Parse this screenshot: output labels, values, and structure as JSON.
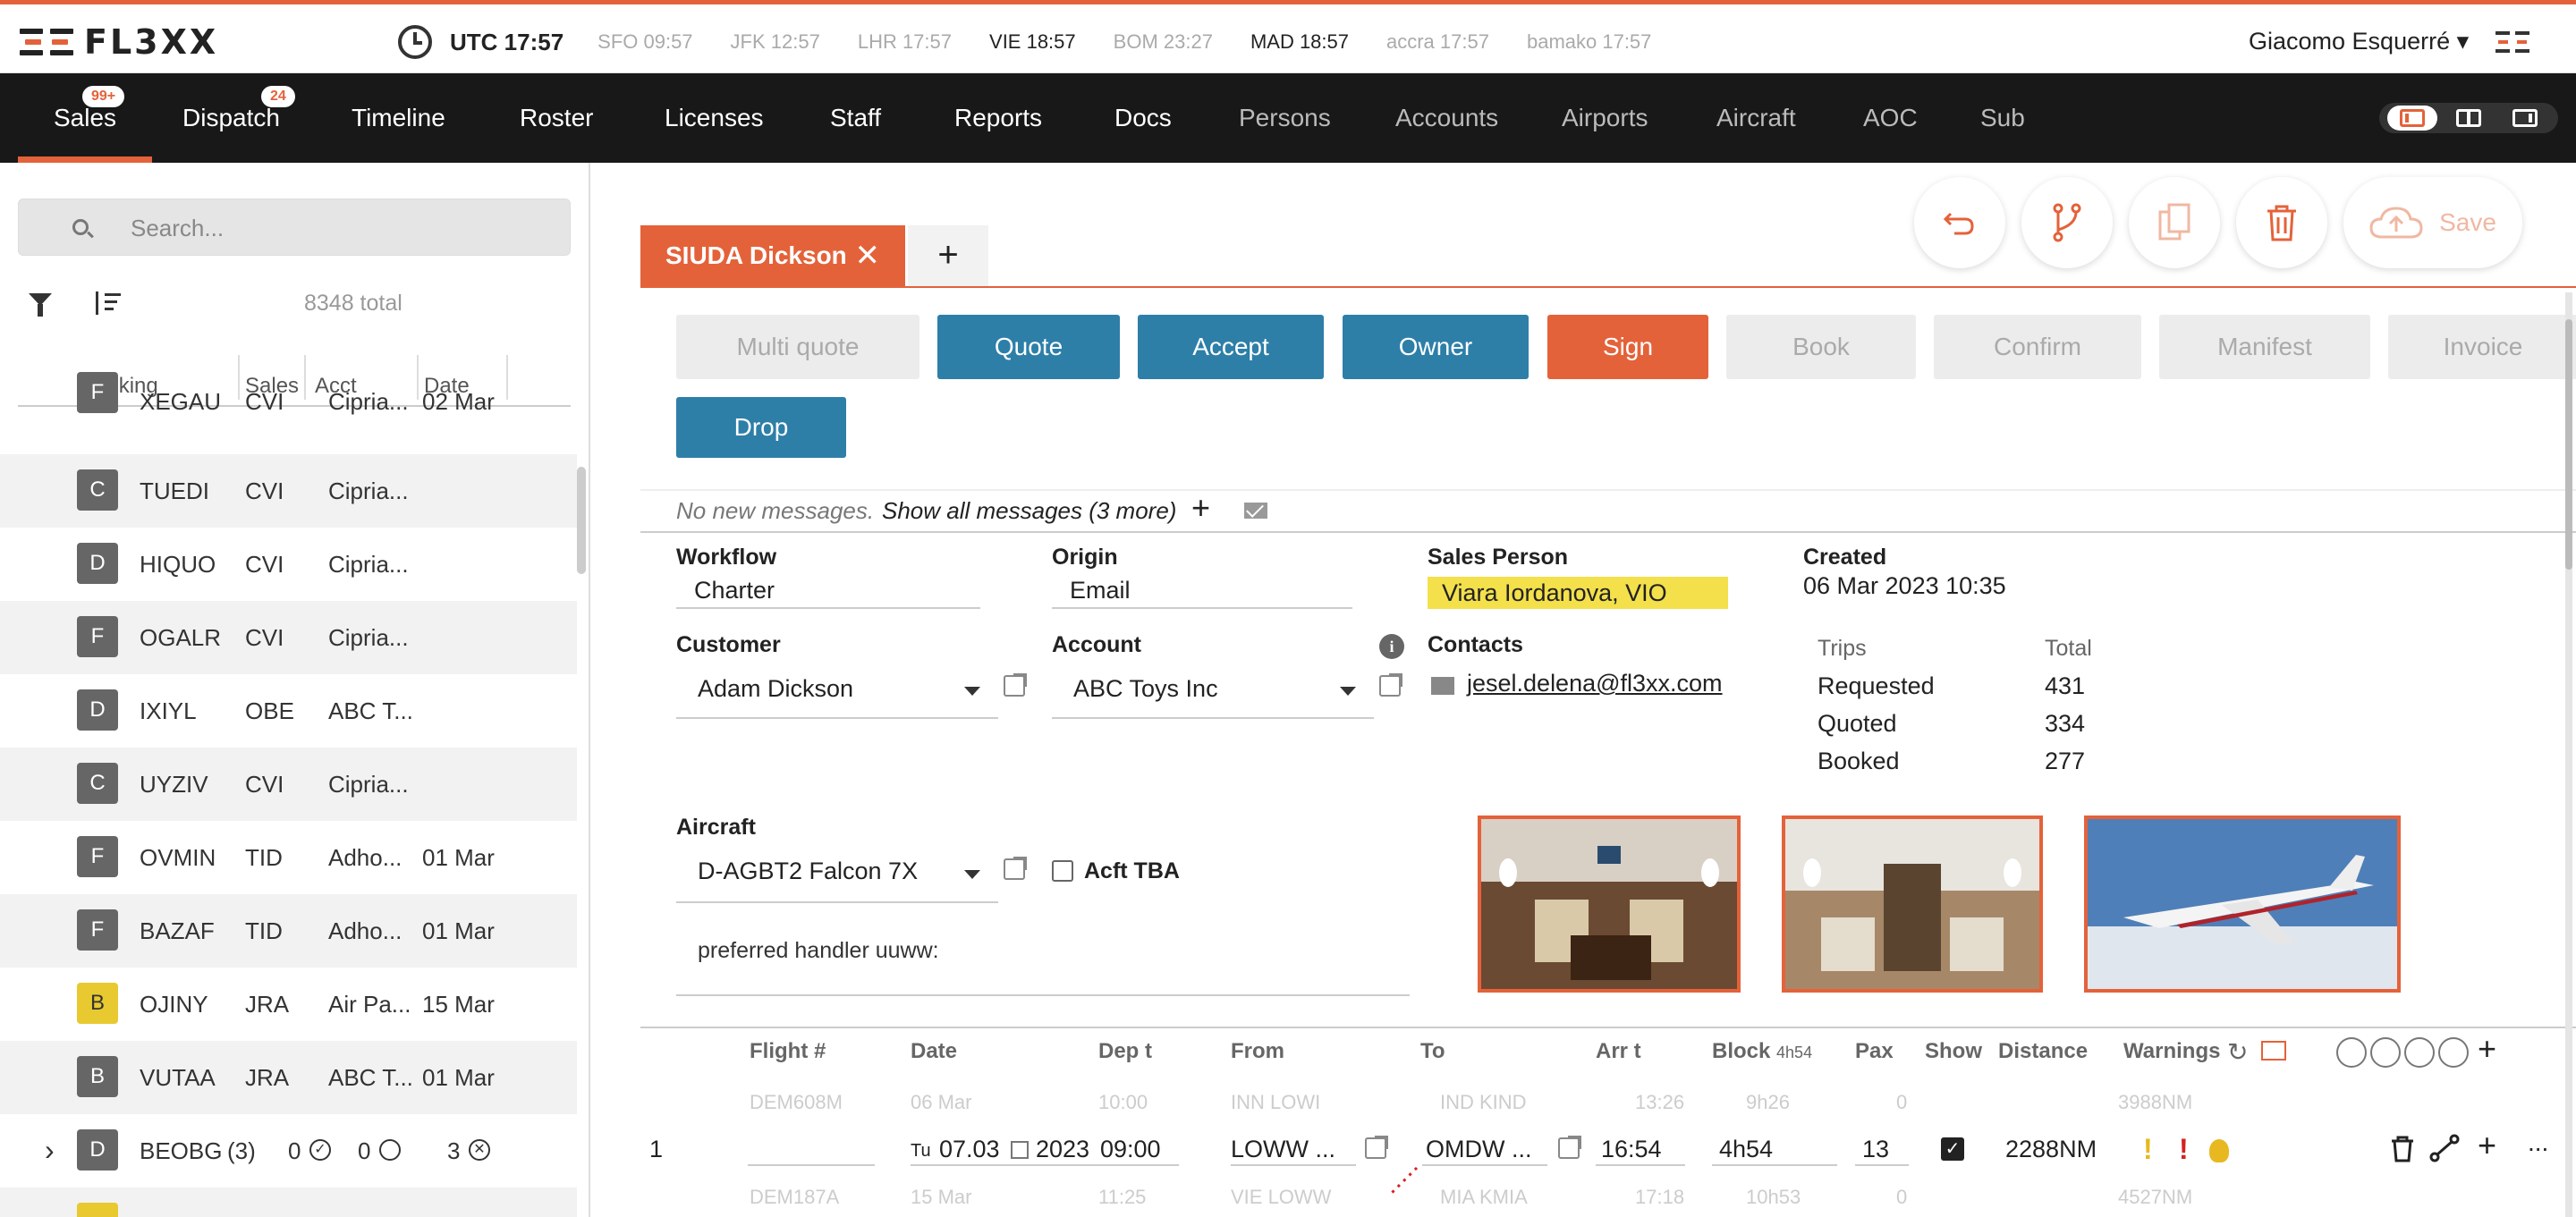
{
  "app": {
    "brand": "FL3XX",
    "accent": "#e4623a"
  },
  "clocks": {
    "utc": "UTC 17:57",
    "zones": [
      "SFO 09:57",
      "JFK 12:57",
      "LHR 17:57",
      "VIE 18:57",
      "BOM 23:27",
      "MAD 18:57",
      "accra 17:57",
      "bamako 17:57"
    ]
  },
  "user": {
    "name": "Giacomo Esquerré ▾"
  },
  "nav": {
    "items": [
      "Sales",
      "Dispatch",
      "Timeline",
      "Roster",
      "Licenses",
      "Staff",
      "Reports",
      "Docs",
      "Persons",
      "Accounts",
      "Airports",
      "Aircraft",
      "AOC",
      "Sub"
    ],
    "badges": {
      "sales": "99+",
      "dispatch": "24"
    },
    "active": "Sales"
  },
  "sidebar": {
    "search_placeholder": "Search...",
    "total": "8348 total",
    "columns": [
      "Booking",
      "Sales",
      "Acct",
      "Date"
    ],
    "rows": [
      {
        "type": "F",
        "booking": "XEGAU",
        "sales": "CVI",
        "acct": "Cipria...",
        "date": "02 Mar"
      },
      {
        "type": "C",
        "booking": "TUEDI",
        "sales": "CVI",
        "acct": "Cipria...",
        "date": ""
      },
      {
        "type": "D",
        "booking": "HIQUO",
        "sales": "CVI",
        "acct": "Cipria...",
        "date": ""
      },
      {
        "type": "F",
        "booking": "OGALR",
        "sales": "CVI",
        "acct": "Cipria...",
        "date": ""
      },
      {
        "type": "D",
        "booking": "IXIYL",
        "sales": "OBE",
        "acct": "ABC T...",
        "date": ""
      },
      {
        "type": "C",
        "booking": "UYZIV",
        "sales": "CVI",
        "acct": "Cipria...",
        "date": ""
      },
      {
        "type": "F",
        "booking": "OVMIN",
        "sales": "TID",
        "acct": "Adho...",
        "date": "01 Mar"
      },
      {
        "type": "F",
        "booking": "BAZAF",
        "sales": "TID",
        "acct": "Adho...",
        "date": "01 Mar"
      },
      {
        "type": "B",
        "booking": "OJINY",
        "sales": "JRA",
        "acct": "Air Pa...",
        "date": "15 Mar"
      },
      {
        "type": "B",
        "booking": "VUTAA",
        "sales": "JRA",
        "acct": "ABC T...",
        "date": "01 Mar"
      }
    ],
    "group": {
      "chevron": "›",
      "type": "D",
      "booking": "BEOBG",
      "count": "(3)",
      "a": "0",
      "b": "0",
      "c": "3"
    }
  },
  "toolbar": {
    "save": "Save"
  },
  "tab": {
    "label": "SIUDA Dickson",
    "close": "✕",
    "add": "+"
  },
  "workflow": {
    "buttons": [
      {
        "label": "Multi quote",
        "state": "grey"
      },
      {
        "label": "Quote",
        "state": "blue"
      },
      {
        "label": "Accept",
        "state": "blue"
      },
      {
        "label": "Owner",
        "state": "blue"
      },
      {
        "label": "Sign",
        "state": "orange"
      },
      {
        "label": "Book",
        "state": "grey"
      },
      {
        "label": "Confirm",
        "state": "grey"
      },
      {
        "label": "Manifest",
        "state": "grey"
      },
      {
        "label": "Invoice",
        "state": "grey"
      },
      {
        "label": "Drop",
        "state": "blue"
      }
    ]
  },
  "messages": {
    "none": "No new messages.",
    "show_all": "Show all messages (3 more)",
    "add": "+"
  },
  "form": {
    "workflow_label": "Workflow",
    "workflow_value": "Charter",
    "origin_label": "Origin",
    "origin_value": "Email",
    "sales_person_label": "Sales Person",
    "sales_person_value": "Viara Iordanova, VIO",
    "created_label": "Created",
    "created_value": "06 Mar 2023 10:35",
    "customer_label": "Customer",
    "customer_value": "Adam Dickson",
    "account_label": "Account",
    "account_value": "ABC Toys Inc",
    "contacts_label": "Contacts",
    "contact_email": "jesel.delena@fl3xx.com",
    "aircraft_label": "Aircraft",
    "aircraft_value": "D-AGBT2 Falcon 7X",
    "acft_tba": "Acft TBA",
    "note": "preferred handler uuww:"
  },
  "trips": {
    "header": [
      "Trips",
      "Total"
    ],
    "rows": [
      [
        "Requested",
        "431"
      ],
      [
        "Quoted",
        "334"
      ],
      [
        "Booked",
        "277"
      ]
    ]
  },
  "flights": {
    "columns": [
      "Flight #",
      "Date",
      "Dep t",
      "From",
      "To",
      "Arr t",
      "Block",
      "Pax",
      "Show",
      "Distance",
      "Warnings"
    ],
    "block_total": "4h54",
    "ghost_prev": [
      "DEM608M",
      "06 Mar",
      "10:00",
      "INN LOWI",
      "IND KIND",
      "13:26",
      "9h26",
      "0",
      "3988NM"
    ],
    "row": {
      "index": "1",
      "weekday": "Tu",
      "date": "07.03",
      "year": "2023",
      "dep": "09:00",
      "from": "LOWW ...",
      "to": "OMDW ...",
      "arr": "16:54",
      "block": "4h54",
      "pax": "13",
      "show": "✓",
      "distance": "2288NM",
      "more": "..."
    },
    "ghost_next": [
      "DEM187A",
      "15 Mar",
      "11:25",
      "VIE LOWW",
      "MIA KMIA",
      "17:18",
      "10h53",
      "0",
      "4527NM"
    ],
    "warning_colors": [
      "#e8b820",
      "#d62020",
      "#e8b820"
    ]
  }
}
